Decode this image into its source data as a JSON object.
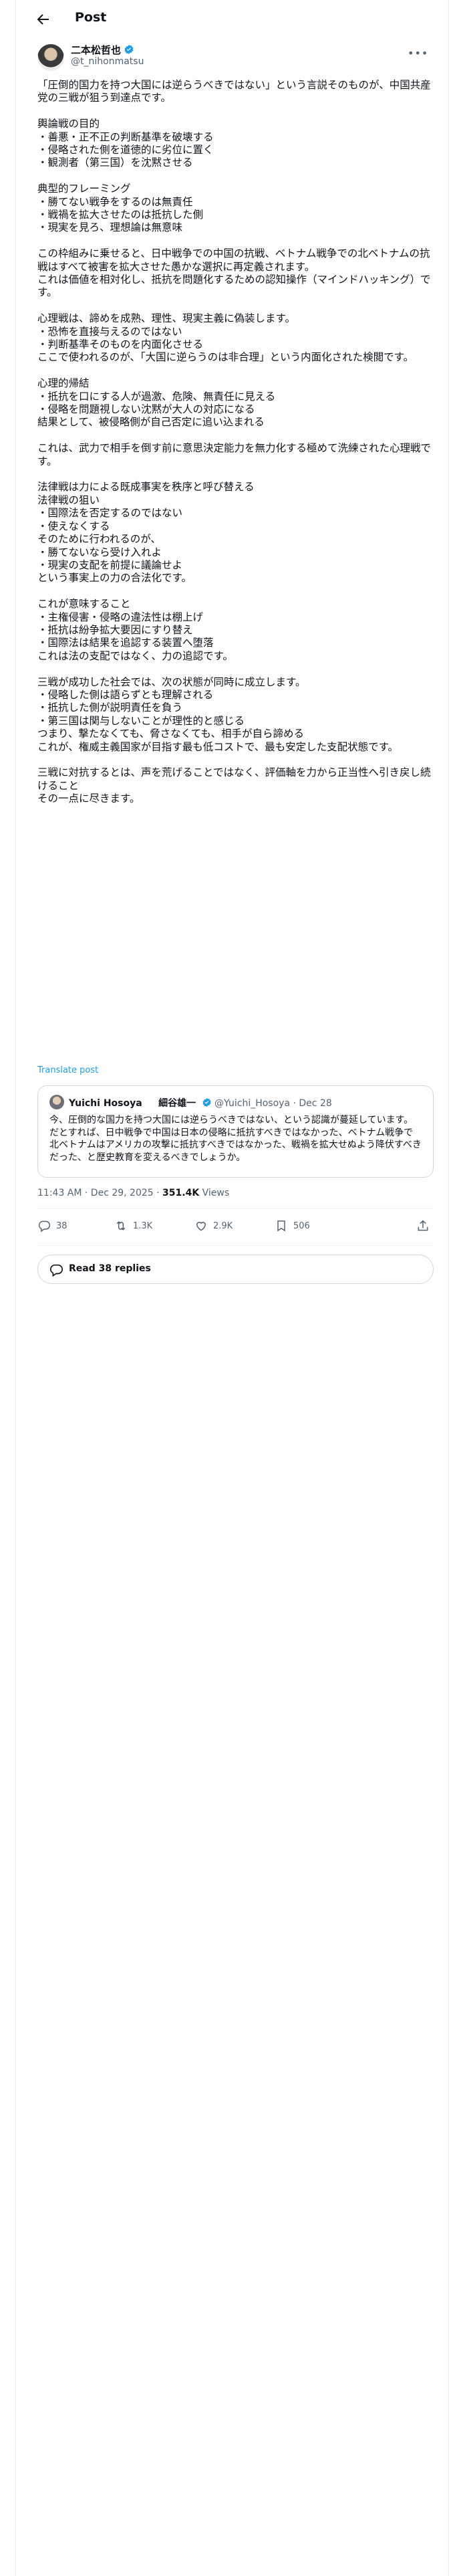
{
  "header": {
    "title": "Post"
  },
  "author": {
    "name": "二本松哲也",
    "handle": "@t_nihonmatsu"
  },
  "post": {
    "paragraphs": [
      "「圧倒的国力を持つ大国には逆らうべきではない」という言説そのものが、中国共産党の三戦が狙う到達点です。",
      "輿論戦の目的\n・善悪・正不正の判断基準を破壊する\n・侵略された側を道徳的に劣位に置く\n・観測者（第三国）を沈黙させる",
      "典型的フレーミング\n・勝てない戦争をするのは無責任\n・戦禍を拡大させたのは抵抗した側\n・現実を見ろ、理想論は無意味",
      "この枠組みに乗せると、日中戦争での中国の抗戦、ベトナム戦争での北ベトナムの抗戦はすべて被害を拡大させた愚かな選択に再定義されます。\nこれは価値を相対化し、抵抗を問題化するための認知操作（マインドハッキング）です。",
      "心理戦は、諦めを成熟、理性、現実主義に偽装します。\n・恐怖を直接与えるのではない\n・判断基準そのものを内面化させる\nここで使われるのが、「大国に逆らうのは非合理」という内面化された検閲です。",
      "心理的帰結\n・抵抗を口にする人が過激、危険、無責任に見える\n・侵略を問題視しない沈黙が大人の対応になる\n結果として、被侵略側が自己否定に追い込まれる",
      "これは、武力で相手を倒す前に意思決定能力を無力化する極めて洗練された心理戦です。",
      "法律戦は力による既成事実を秩序と呼び替える\n法律戦の狙い\n・国際法を否定するのではない\n・使えなくする\nそのために行われるのが、\n・勝てないなら受け入れよ\n・現実の支配を前提に議論せよ\nという事実上の力の合法化です。",
      "これが意味すること\n・主権侵害・侵略の違法性は棚上げ\n・抵抗は紛争拡大要因にすり替え\n・国際法は結果を追認する装置へ堕落\nこれは法の支配ではなく、力の追認です。",
      "三戦が成功した社会では、次の状態が同時に成立します。\n・侵略した側は語らずとも理解される\n・抵抗した側が説明責任を負う\n・第三国は関与しないことが理性的と感じる\nつまり、撃たなくても、脅さなくても、相手が自ら諦める\nこれが、権威主義国家が目指す最も低コストで、最も安定した支配状態です。",
      "三戦に対抗するとは、声を荒げることではなく、評価軸を力から正当性へ引き戻し続けること\nその一点に尽きます。"
    ],
    "translate_label": "Translate post"
  },
  "quote": {
    "name_en": "Yuichi Hosoya",
    "name_jp": "細谷雄一",
    "handle": "@Yuichi_Hosoya",
    "date": "· Dec 28",
    "text": "今、圧倒的な国力を持つ大国には逆らうべきではない、という認識が蔓延しています。だとすれば、日中戦争で中国は日本の侵略に抵抗すべきではなかった、ベトナム戦争で北ベトナムはアメリカの攻撃に抵抗すべきではなかった、戦禍を拡大せぬよう降伏すべきだった、と歴史教育を変えるべきでしょうか。"
  },
  "meta": {
    "time": "11:43 AM · Dec 29, 2025 · ",
    "views_count": "351.4K",
    "views_label": " Views"
  },
  "actions": {
    "replies": "38",
    "reposts": "1.3K",
    "likes": "2.9K",
    "bookmarks": "506"
  },
  "read_replies": "Read 38 replies",
  "colors": {
    "accent": "#1d9bf0",
    "text": "#0f1419",
    "secondary": "#536471",
    "border": "#cfd9de"
  }
}
